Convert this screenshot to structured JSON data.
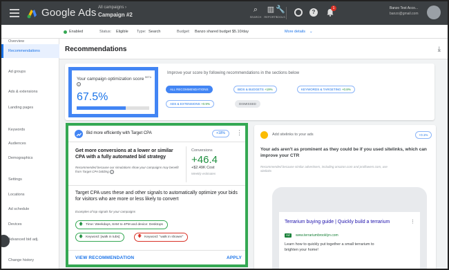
{
  "header": {
    "brand": "Google Ads",
    "crumb_small": "All campaigns  ›",
    "crumb_big": "Campaign #2",
    "icons": [
      {
        "name": "search-icon",
        "glyph": "⌕",
        "label": "SEARCH"
      },
      {
        "name": "reports-icon",
        "glyph": "▥",
        "label": "REPORTS"
      },
      {
        "name": "tools-icon",
        "glyph": "🔧",
        "label": "TOOLS"
      }
    ],
    "notification_count": "1",
    "account_name": "Banzo Test Acco...",
    "account_email": "banzo@gmail.com"
  },
  "statusbar": {
    "status": "Enabled",
    "status_label": "Status:",
    "status_value": "Eligible",
    "type_label": "Type:",
    "type_value": "Search",
    "budget_label": "Budget:",
    "budget_value": "Banzo shared budget $5.10/day",
    "more_details": "More details"
  },
  "sidebar": {
    "items": [
      {
        "label": "Overview",
        "active": false
      },
      {
        "label": "Recommendations",
        "active": true
      },
      {
        "label": "Ad groups",
        "active": false
      },
      {
        "label": "Ads & extensions",
        "active": false
      },
      {
        "label": "Landing pages",
        "active": false
      },
      {
        "label": "Keywords",
        "active": false
      },
      {
        "label": "Audiences",
        "active": false
      },
      {
        "label": "Demographics",
        "active": false
      },
      {
        "label": "Settings",
        "active": false
      },
      {
        "label": "Locations",
        "active": false
      },
      {
        "label": "Ad schedule",
        "active": false
      },
      {
        "label": "Devices",
        "active": false
      },
      {
        "label": "Advanced bid adj.",
        "active": false
      },
      {
        "label": "Change history",
        "active": false
      }
    ]
  },
  "page": {
    "title": "Recommendations"
  },
  "optimization": {
    "title": "Your campaign optimization score",
    "beta": "BETA",
    "score": "67.5%",
    "score_fraction": 0.675
  },
  "improve_text": "Improve your score by following recommendations in the sections below",
  "chips": [
    {
      "label": "ALL RECOMMENDATIONS",
      "pct": "",
      "style": "sel"
    },
    {
      "label": "BIDS & BUDGETS",
      "pct": "+19%",
      "style": "outline"
    },
    {
      "label": "KEYWORDS & TARGETING",
      "pct": "+0.8%",
      "style": "outline"
    },
    {
      "label": "ADS & EXTENSIONS",
      "pct": "+0.9%",
      "style": "outline"
    },
    {
      "label": "DISMISSED",
      "pct": "",
      "style": "grey"
    }
  ],
  "card_cpa": {
    "title": "Bid more efficiently with Target CPA",
    "score": "+18%",
    "headline": "Get more conversions at a lower or similar CPA with a fully automated bid strategy",
    "note": "Recommended because our simulations show your campaigns may benefit from Target CPA bidding",
    "conversions_label": "Conversions",
    "conversions_value": "+46.4",
    "cost": "+$2.49K Cost",
    "weekly": "Weekly estimates",
    "body": "Target CPA uses these and other signals to automatically optimize your bids for visitors who are more or less likely to convert",
    "examples_label": "Examples of top signals for your campaigns",
    "signals": [
      {
        "text": "Time: Weekdays, 8AM to 4PM and device: Desktops",
        "dir": "up"
      },
      {
        "text": "Keyword: [walk in tubs]",
        "dir": "up"
      },
      {
        "text": "Keyword: \"walk in shower\"",
        "dir": "down"
      }
    ],
    "view_label": "VIEW RECOMMENDATION",
    "apply_label": "APPLY"
  },
  "card_sitelinks": {
    "title": "Add sitelinks to your ads",
    "score": "+0.1%",
    "headline": "Your ads aren't as prominent as they could be if you used sitelinks, which can improve your CTR",
    "note": "Recommended because similar advertisers, including amazon.com and proflowers.com, use sitelinks",
    "ad_title": "Terrarium buying guide | Quickly build a terrarium",
    "ad_badge": "Ad",
    "ad_url": "www.terrariumbrooklyn.com",
    "ad_desc": "Learn how to quickly put together a small terrarium to brighten your home!"
  }
}
